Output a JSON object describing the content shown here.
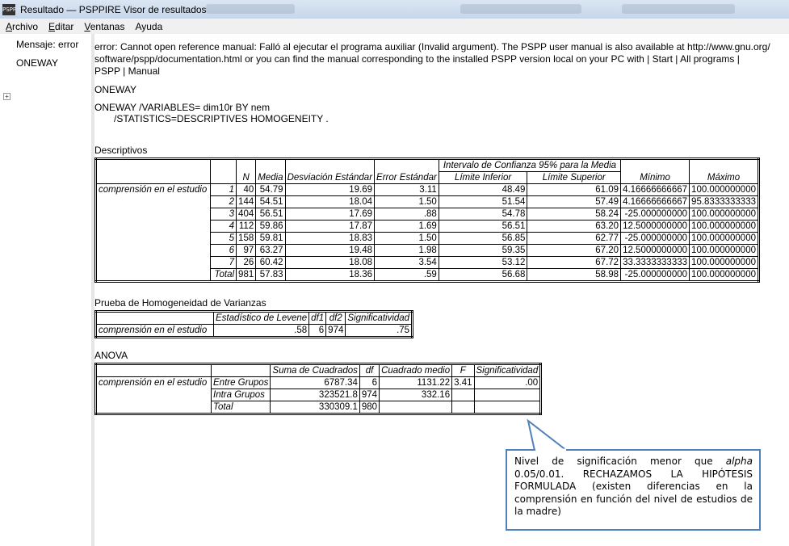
{
  "window": {
    "title": "Resultado — PSPPIRE Visor de resultados",
    "icon": "pspp-app-icon",
    "icon_text": "PSPP"
  },
  "menu": [
    {
      "u": "A",
      "rest": "rchivo"
    },
    {
      "u": "E",
      "rest": "ditar"
    },
    {
      "u": "V",
      "rest": "entanas"
    },
    {
      "u": "",
      "rest": "Ayuda"
    }
  ],
  "sidebar": {
    "items": [
      "Mensaje: error",
      "ONEWAY"
    ]
  },
  "error_lines": [
    "error: Cannot open reference manual: Falló al ejecutar el programa auxiliar (Invalid argument).  The PSPP user manual is also available at http://www.gnu.org/",
    "software/pspp/documentation.html or you can find the manual corresponding to the installed PSPP version local on your PC with | Start | All programs |",
    "PSPP | Manual"
  ],
  "heading": "ONEWAY",
  "syntax": [
    "ONEWAY /VARIABLES= dim10r BY nem",
    "/STATISTICS=DESCRIPTIVES HOMOGENEITY ."
  ],
  "descriptivos": {
    "title": "Descriptivos",
    "group_header": "Intervalo de Confianza 95% para la Media",
    "headers": [
      "N",
      "Media",
      "Desviación Estándar",
      "Error Estándar",
      "Límite Inferior",
      "Límite Superior",
      "Mínimo",
      "Máximo"
    ],
    "row_label": "comprensión en el estudio",
    "rows": [
      [
        "1",
        "40",
        "54.79",
        "19.69",
        "3.11",
        "48.49",
        "61.09",
        "4.16666666667",
        "100.000000000"
      ],
      [
        "2",
        "144",
        "54.51",
        "18.04",
        "1.50",
        "51.54",
        "57.49",
        "4.16666666667",
        "95.8333333333"
      ],
      [
        "3",
        "404",
        "56.51",
        "17.69",
        ".88",
        "54.78",
        "58.24",
        "-25.000000000",
        "100.000000000"
      ],
      [
        "4",
        "112",
        "59.86",
        "17.87",
        "1.69",
        "56.51",
        "63.20",
        "12.5000000000",
        "100.000000000"
      ],
      [
        "5",
        "158",
        "59.81",
        "18.83",
        "1.50",
        "56.85",
        "62.77",
        "-25.000000000",
        "100.000000000"
      ],
      [
        "6",
        "97",
        "63.27",
        "19.48",
        "1.98",
        "59.35",
        "67.20",
        "12.5000000000",
        "100.000000000"
      ],
      [
        "7",
        "26",
        "60.42",
        "18.08",
        "3.54",
        "53.12",
        "67.72",
        "33.3333333333",
        "100.000000000"
      ],
      [
        "Total",
        "981",
        "57.83",
        "18.36",
        ".59",
        "56.68",
        "58.98",
        "-25.000000000",
        "100.000000000"
      ]
    ]
  },
  "homogeneidad": {
    "title": "Prueba de Homogeneidad de Varianzas",
    "headers": [
      "Estadístico de Levene",
      "df1",
      "df2",
      "Significatividad"
    ],
    "row_label": "comprensión en el estudio",
    "row": [
      ".58",
      "6",
      "974",
      ".75"
    ]
  },
  "anova": {
    "title": "ANOVA",
    "headers": [
      "Suma de Cuadrados",
      "df",
      "Cuadrado medio",
      "F",
      "Significatividad"
    ],
    "row_label": "comprensión en el estudio",
    "rows": [
      [
        "Entre Grupos",
        "6787.34",
        "6",
        "1131.22",
        "3.41",
        ".00"
      ],
      [
        "Intra Grupos",
        "323521.8",
        "974",
        "332.16",
        "",
        ""
      ],
      [
        "Total",
        "330309.1",
        "980",
        "",
        "",
        ""
      ]
    ]
  },
  "callout": {
    "pre": "Nivel de significación menor que ",
    "em": "alpha",
    "post": " 0.05/0.01. RECHAZAMOS LA HIPÓTESIS FORMULADA (existen diferencias en la comprensión en función del nivel de estudios de la madre)",
    "border_color": "#4f81bd"
  }
}
